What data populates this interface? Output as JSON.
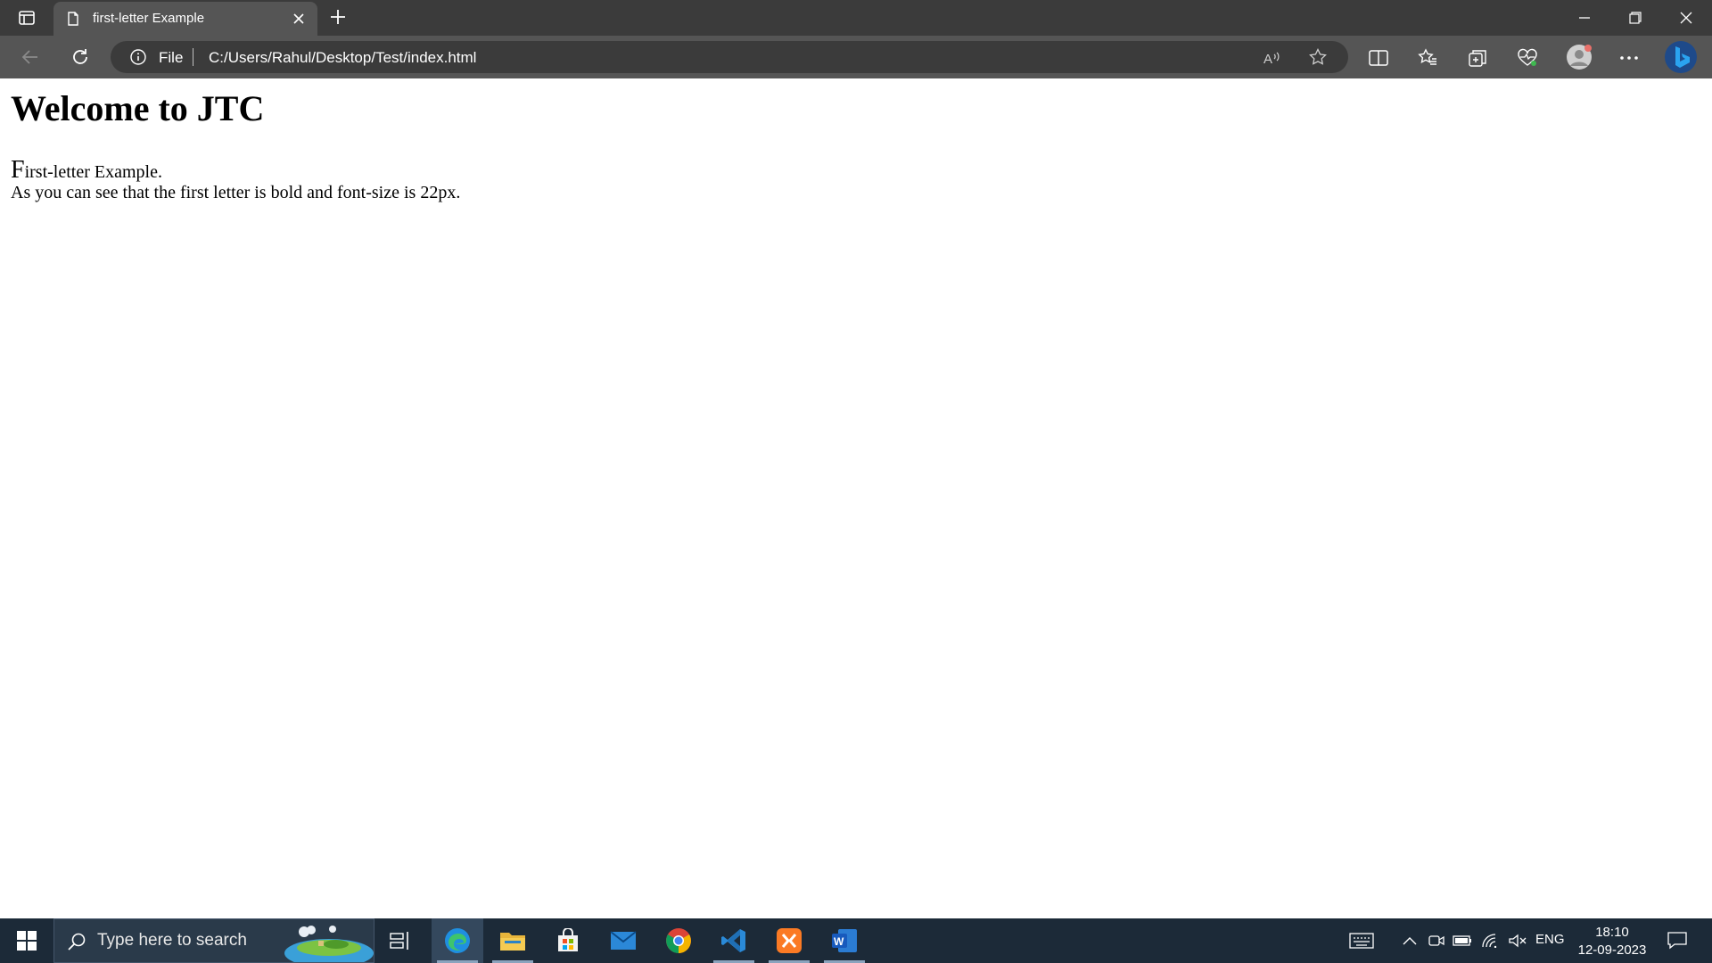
{
  "browser": {
    "tab": {
      "title": "first-letter Example"
    },
    "address": {
      "scheme": "File",
      "url": "C:/Users/Rahul/Desktop/Test/index.html"
    }
  },
  "page": {
    "heading": "Welcome to JTC",
    "paragraph1": {
      "first_letter": "F",
      "rest": "irst-letter Example."
    },
    "paragraph2": "As you can see that the first letter is bold and font-size is 22px."
  },
  "taskbar": {
    "search_placeholder": "Type here to search",
    "apps": [
      "task-view",
      "edge",
      "file-explorer",
      "microsoft-store",
      "mail",
      "chrome",
      "vscode",
      "xampp",
      "word"
    ],
    "tray": {
      "language": "ENG",
      "time": "18:10",
      "date": "12-09-2023"
    }
  },
  "colors": {
    "tabbar_bg": "#3b3b3b",
    "navbar_bg": "#555555",
    "taskbar_bg": "#1c2a38",
    "edge_blue": "#1f8fe0",
    "bing_blue": "#2aa3f0"
  }
}
